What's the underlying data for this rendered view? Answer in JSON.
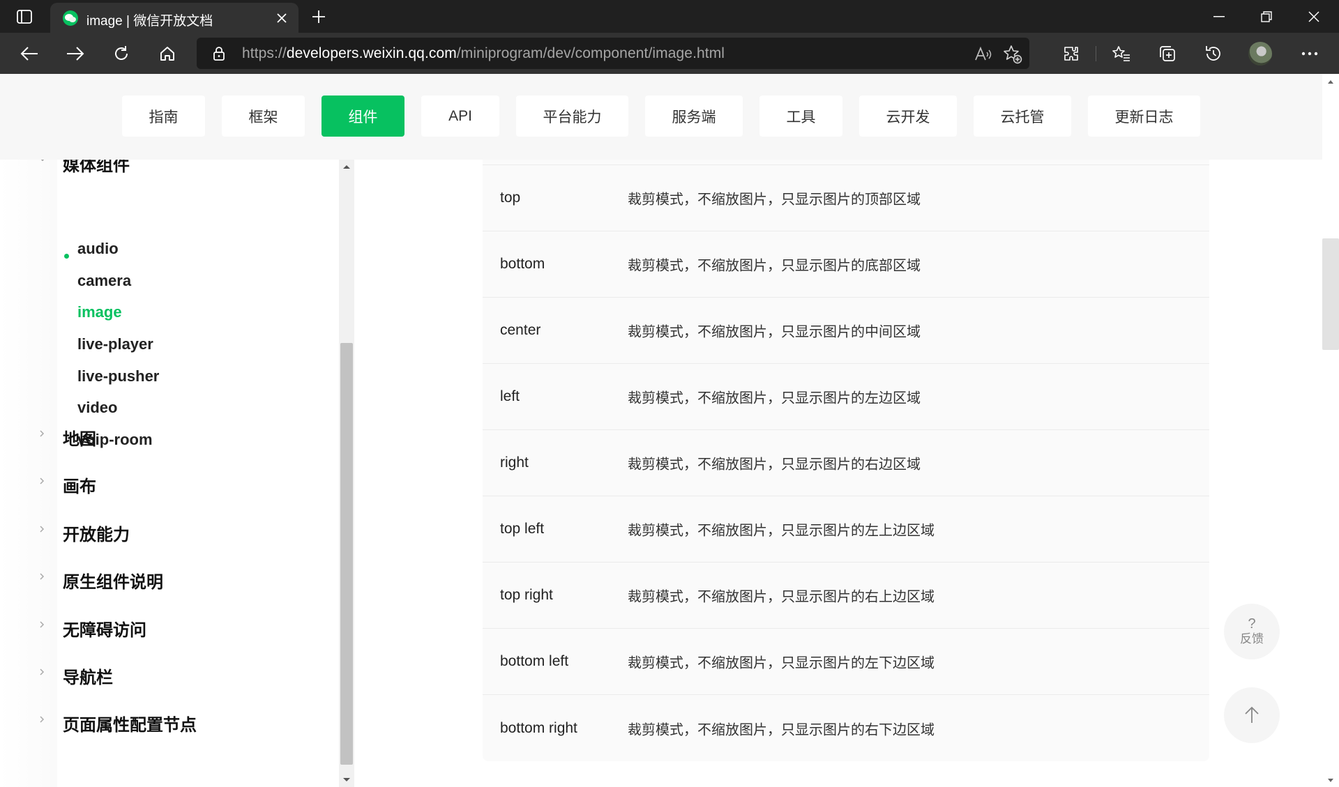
{
  "browser": {
    "tab_title": "image | 微信开放文档",
    "url_scheme": "https://",
    "url_domain": "developers.weixin.qq.com",
    "url_path": "/miniprogram/dev/component/image.html"
  },
  "topnav": {
    "items": [
      {
        "label": "指南"
      },
      {
        "label": "框架"
      },
      {
        "label": "组件"
      },
      {
        "label": "API"
      },
      {
        "label": "平台能力"
      },
      {
        "label": "服务端"
      },
      {
        "label": "工具"
      },
      {
        "label": "云开发"
      },
      {
        "label": "云托管"
      },
      {
        "label": "更新日志"
      }
    ],
    "active": "组件"
  },
  "sidebar": {
    "partial_group": "媒体组件",
    "items": [
      {
        "label": "audio"
      },
      {
        "label": "camera"
      },
      {
        "label": "image"
      },
      {
        "label": "live-player"
      },
      {
        "label": "live-pusher"
      },
      {
        "label": "video"
      },
      {
        "label": "voip-room"
      }
    ],
    "groups": [
      {
        "label": "地图"
      },
      {
        "label": "画布"
      },
      {
        "label": "开放能力"
      },
      {
        "label": "原生组件说明"
      },
      {
        "label": "无障碍访问"
      },
      {
        "label": "导航栏"
      },
      {
        "label": "页面属性配置节点"
      }
    ]
  },
  "table": {
    "rows": [
      {
        "key": "top",
        "desc": "裁剪模式，不缩放图片，只显示图片的顶部区域"
      },
      {
        "key": "bottom",
        "desc": "裁剪模式，不缩放图片，只显示图片的底部区域"
      },
      {
        "key": "center",
        "desc": "裁剪模式，不缩放图片，只显示图片的中间区域"
      },
      {
        "key": "left",
        "desc": "裁剪模式，不缩放图片，只显示图片的左边区域"
      },
      {
        "key": "right",
        "desc": "裁剪模式，不缩放图片，只显示图片的右边区域"
      },
      {
        "key": "top left",
        "desc": "裁剪模式，不缩放图片，只显示图片的左上边区域"
      },
      {
        "key": "top right",
        "desc": "裁剪模式，不缩放图片，只显示图片的右上边区域"
      },
      {
        "key": "bottom left",
        "desc": "裁剪模式，不缩放图片，只显示图片的左下边区域"
      },
      {
        "key": "bottom right",
        "desc": "裁剪模式，不缩放图片，只显示图片的右下边区域"
      }
    ]
  },
  "floating": {
    "feedback_symbol": "?",
    "feedback_label": "反馈"
  },
  "colors": {
    "accent": "#07c160",
    "chrome_dark": "#202020",
    "chrome_toolbar": "#323232"
  }
}
